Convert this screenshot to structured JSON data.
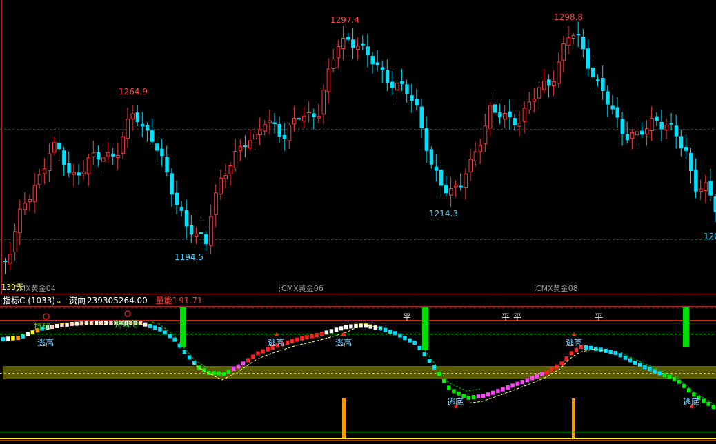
{
  "colors": {
    "background": "#000000",
    "up": "#ff3b3b",
    "down": "#00e0ff",
    "grid_red": "#8a1c1c",
    "high_label": "#ff4545",
    "low_label": "#3fd8ff",
    "yellow": "#ffff00",
    "green": "#00dd00",
    "magenta": "#ff44ff",
    "olive": "#5a5a00",
    "orange": "#ff9900"
  },
  "main_chart": {
    "labels": {
      "high1": "1264.9",
      "high2": "1297.4",
      "high3": "1298.8",
      "low1": "1194.5",
      "low2": "1214.3",
      "low3": "120"
    },
    "days_label": "139天",
    "contracts": [
      "CMX黄金04",
      "CMX黄金06",
      "CMX黄金08"
    ]
  },
  "indicator": {
    "name": "指标C (1033)",
    "dropdown_icon": "chevron-down-icon",
    "fund_label": "资向",
    "fund_value": "239305264.00",
    "energy_label": "量能1",
    "energy_value": "91.71",
    "signals": {
      "flat": "平",
      "escape_high": "逃高",
      "escape_low": "逃底",
      "hold": "持现",
      "hold_wait": "持现等"
    }
  }
}
